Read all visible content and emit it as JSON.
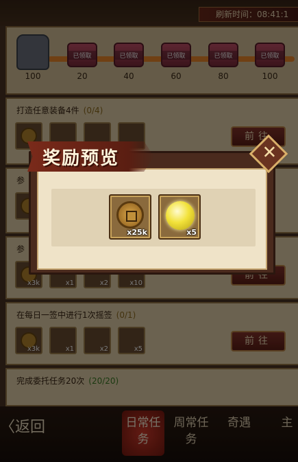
{
  "header": {
    "refresh_label": "刷新时间：08:41:1"
  },
  "progress": {
    "milestones": [
      "100",
      "20",
      "40",
      "60",
      "80",
      "100"
    ],
    "chest_label": "已领取"
  },
  "tasks": [
    {
      "title": "打造任意装备4件",
      "count": "(0/4)",
      "button": "前往"
    },
    {
      "title": "参",
      "count": "",
      "button": ""
    },
    {
      "title": "参",
      "count": "",
      "button": "前往",
      "rewards": [
        "x3k",
        "x1",
        "x2",
        "x10"
      ]
    },
    {
      "title": "在每日一签中进行1次摇签",
      "count": "(0/1)",
      "button": "前往",
      "rewards": [
        "x3k",
        "x1",
        "x2",
        "x5"
      ]
    },
    {
      "title": "完成委托任务20次",
      "count": "(20/20)",
      "button": ""
    }
  ],
  "bottom_nav": {
    "back_label": "〈返回",
    "tabs": [
      "日常任务",
      "周常任务",
      "奇遇",
      "主"
    ]
  },
  "modal": {
    "title": "奖励预览",
    "close_icon": "close-x-icon",
    "rewards": [
      {
        "icon": "copper-coin-icon",
        "qty": "x25k"
      },
      {
        "icon": "golden-pearl-icon",
        "qty": "x5"
      }
    ]
  }
}
